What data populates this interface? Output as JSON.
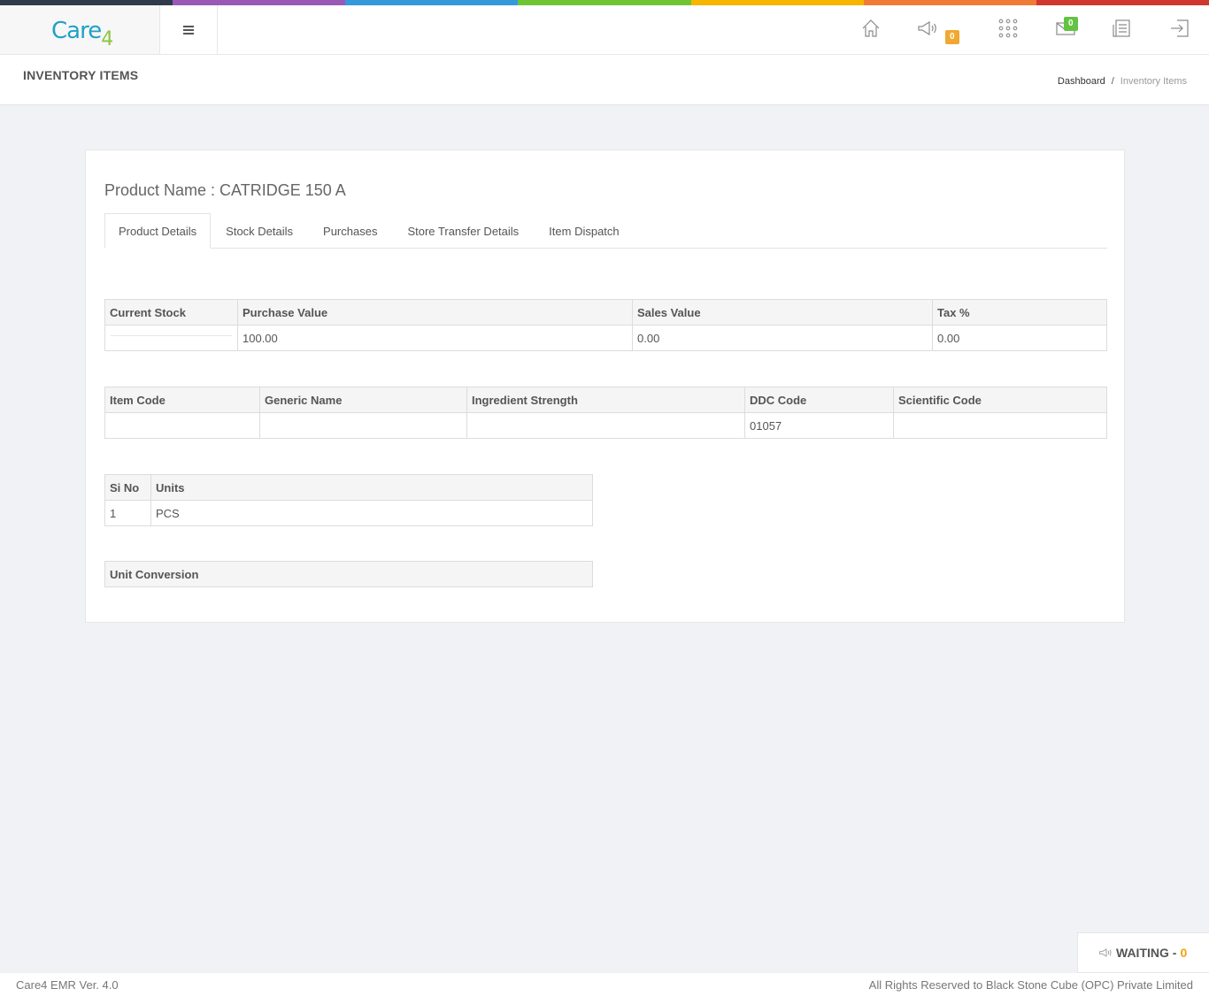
{
  "colors": {
    "top_bar": [
      "#2f3b4a",
      "#9b59b6",
      "#3498db",
      "#6dc534",
      "#f7b500",
      "#f07b35",
      "#d0372f"
    ],
    "logo_primary": "#1fa1c7",
    "logo_accent": "#8cc63f",
    "badge_orange": "#f0a830",
    "badge_green": "#62c442",
    "waiting_count": "#f0a30a"
  },
  "header": {
    "logo_main": "Care",
    "logo_sub": "4",
    "menu_icon": "hamburger-icon",
    "icons": [
      {
        "name": "home-icon"
      },
      {
        "name": "announcement-icon",
        "badge": "0"
      },
      {
        "name": "apps-grid-icon"
      },
      {
        "name": "mail-icon",
        "badge": "0"
      },
      {
        "name": "reports-icon"
      },
      {
        "name": "logout-icon"
      }
    ]
  },
  "page": {
    "title": "INVENTORY ITEMS",
    "breadcrumb": {
      "home": "Dashboard",
      "separator": "/",
      "current": "Inventory Items"
    }
  },
  "product": {
    "name_label": "Product Name : CATRIDGE 150 A",
    "tabs": [
      {
        "label": "Product Details",
        "active": true
      },
      {
        "label": "Stock Details",
        "active": false
      },
      {
        "label": "Purchases",
        "active": false
      },
      {
        "label": "Store Transfer Details",
        "active": false
      },
      {
        "label": "Item Dispatch",
        "active": false
      }
    ]
  },
  "stock_table": {
    "headers": [
      "Current Stock",
      "Purchase Value",
      "Sales Value",
      "Tax %"
    ],
    "row": [
      "",
      "100.00",
      "0.00",
      "0.00"
    ]
  },
  "code_table": {
    "headers": [
      "Item Code",
      "Generic Name",
      "Ingredient Strength",
      "DDC Code",
      "Scientific Code"
    ],
    "row": [
      "",
      "",
      "",
      "01057",
      ""
    ]
  },
  "units_table": {
    "headers": [
      "Si No",
      "Units"
    ],
    "rows": [
      [
        "1",
        "PCS"
      ]
    ]
  },
  "conversion_table": {
    "headers": [
      "Unit Conversion"
    ]
  },
  "waiting": {
    "label": "WAITING -",
    "count": "0",
    "icon": "announcement-icon"
  },
  "footer": {
    "version": "Care4 EMR Ver. 4.0",
    "rights": "All Rights Reserved to Black Stone Cube (OPC) Private Limited"
  }
}
